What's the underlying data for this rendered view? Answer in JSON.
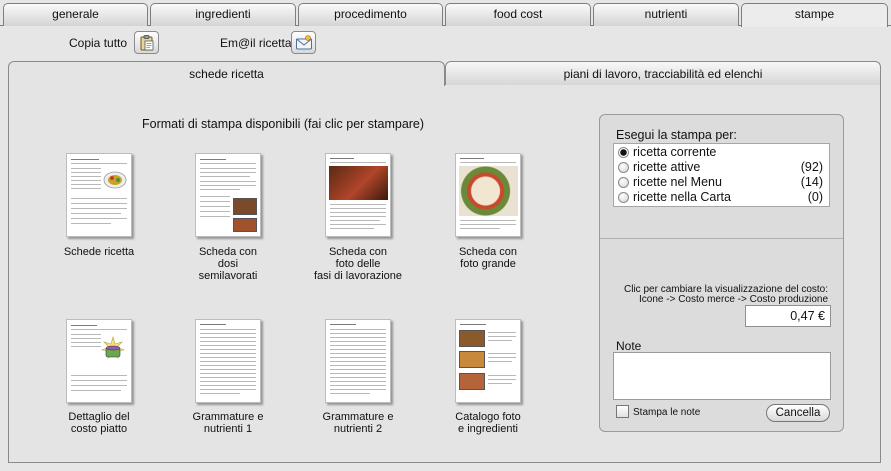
{
  "tabs": [
    {
      "label": "generale",
      "active": false
    },
    {
      "label": "ingredienti",
      "active": false
    },
    {
      "label": "procedimento",
      "active": false
    },
    {
      "label": "food cost",
      "active": false
    },
    {
      "label": "nutrienti",
      "active": false
    },
    {
      "label": "stampe",
      "active": true
    }
  ],
  "toolbar": {
    "copy_label": "Copia tutto",
    "email_label": "Em@il ricetta"
  },
  "subtabs": [
    {
      "label": "schede ricetta",
      "active": true
    },
    {
      "label": "piani di lavoro, tracciabilità ed elenchi",
      "active": false
    }
  ],
  "formats": {
    "title": "Formati di stampa disponibili (fai clic per stampare)",
    "items": [
      {
        "lines": [
          "Schede ricetta"
        ]
      },
      {
        "lines": [
          "Scheda con",
          "dosi",
          "semilavorati"
        ]
      },
      {
        "lines": [
          "Scheda con",
          "foto delle",
          "fasi di lavorazione"
        ]
      },
      {
        "lines": [
          "Scheda con",
          "foto grande"
        ]
      },
      {
        "lines": [
          "Dettaglio del",
          "costo piatto"
        ]
      },
      {
        "lines": [
          "Grammature e",
          "nutrienti 1"
        ]
      },
      {
        "lines": [
          "Grammature e",
          "nutrienti 2"
        ]
      },
      {
        "lines": [
          "Catalogo foto",
          "e ingredienti"
        ]
      }
    ]
  },
  "print_panel": {
    "title": "Esegui la stampa per:",
    "options": [
      {
        "label": "ricetta corrente",
        "count": "",
        "selected": true
      },
      {
        "label": "ricette attive",
        "count": "(92)",
        "selected": false
      },
      {
        "label": "ricette nel Menu",
        "count": "(14)",
        "selected": false
      },
      {
        "label": "ricette nella Carta",
        "count": "(0)",
        "selected": false
      }
    ],
    "cost_note_1": "Clic per cambiare la visualizzazione del costo:",
    "cost_note_2": "Icone -> Costo merce -> Costo produzione",
    "cost_value": "0,47 €",
    "note_label": "Note",
    "note_value": "",
    "print_notes_label": "Stampa le note",
    "print_notes_checked": false,
    "cancel_label": "Cancella"
  }
}
